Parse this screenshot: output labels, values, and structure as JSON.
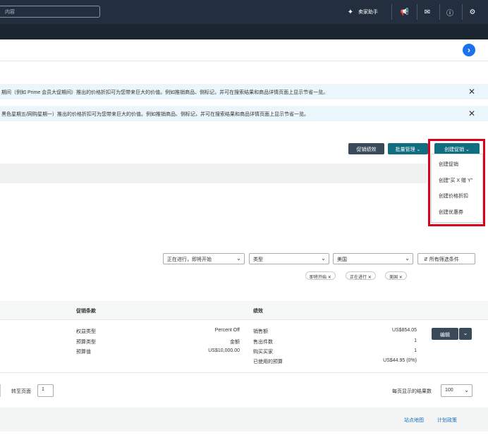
{
  "topbar": {
    "search_placeholder": "内容",
    "assistant_label": "卖家助手",
    "icons": [
      "sparkle-icon",
      "megaphone-icon",
      "mail-icon",
      "help-icon",
      "gear-icon"
    ]
  },
  "header": {
    "help_glyph": "›"
  },
  "banners": [
    {
      "text": "期间（例如 Prime 会员大促期间）推出的价格折扣可为您带来巨大的价值。例如推销商品、侧标记，并可在搜索结果和商品详情页面上显示节省一览。",
      "close": "✕"
    },
    {
      "text": "黑色星期五/网购星期一）推出的价格折扣可为您带来巨大的价值。例如推销商品、侧标记，并可在搜索结果和商品详情页面上显示节省一览。",
      "close": "✕"
    }
  ],
  "actions": {
    "performance_label": "促销绩效",
    "bulk_label": "批量管理",
    "create_label": "创建促销",
    "menu": [
      "创建促销",
      "创建\"买 X 赠 Y\"",
      "创建价格折扣",
      "创建优惠券"
    ]
  },
  "filters": {
    "status": "正在进行，即将开始",
    "type": "类型",
    "marketplace": "美国",
    "all_filters": "所有筛选条件",
    "chips": [
      "即将开始",
      "正在进行",
      "美国"
    ],
    "chip_close": "✕"
  },
  "table": {
    "col_terms": "促销条款",
    "col_performance": "绩效",
    "terms": [
      {
        "label": "权益类型",
        "value": "Percent Off"
      },
      {
        "label": "预算类型",
        "value": "金额"
      },
      {
        "label": "预算值",
        "value": "US$10,000.00"
      }
    ],
    "performance": [
      {
        "label": "销售额",
        "value": "US$854.05"
      },
      {
        "label": "售出件数",
        "value": "1"
      },
      {
        "label": "购买买家",
        "value": "1"
      },
      {
        "label": "已使用的预算",
        "value": "US$44.95 (0%)"
      }
    ],
    "edit_label": "编辑"
  },
  "pagination": {
    "goto_label": "转至页面",
    "goto_value": "1",
    "per_page_label": "每页显示的结果数",
    "per_page_value": "100"
  },
  "footer": {
    "sitemap": "站点地图",
    "policy": "计划政策"
  },
  "colors": {
    "topbar": "#232f3e",
    "accent_teal": "#0f6e80",
    "highlight_red": "#d9001b",
    "link": "#1a6fb8"
  }
}
